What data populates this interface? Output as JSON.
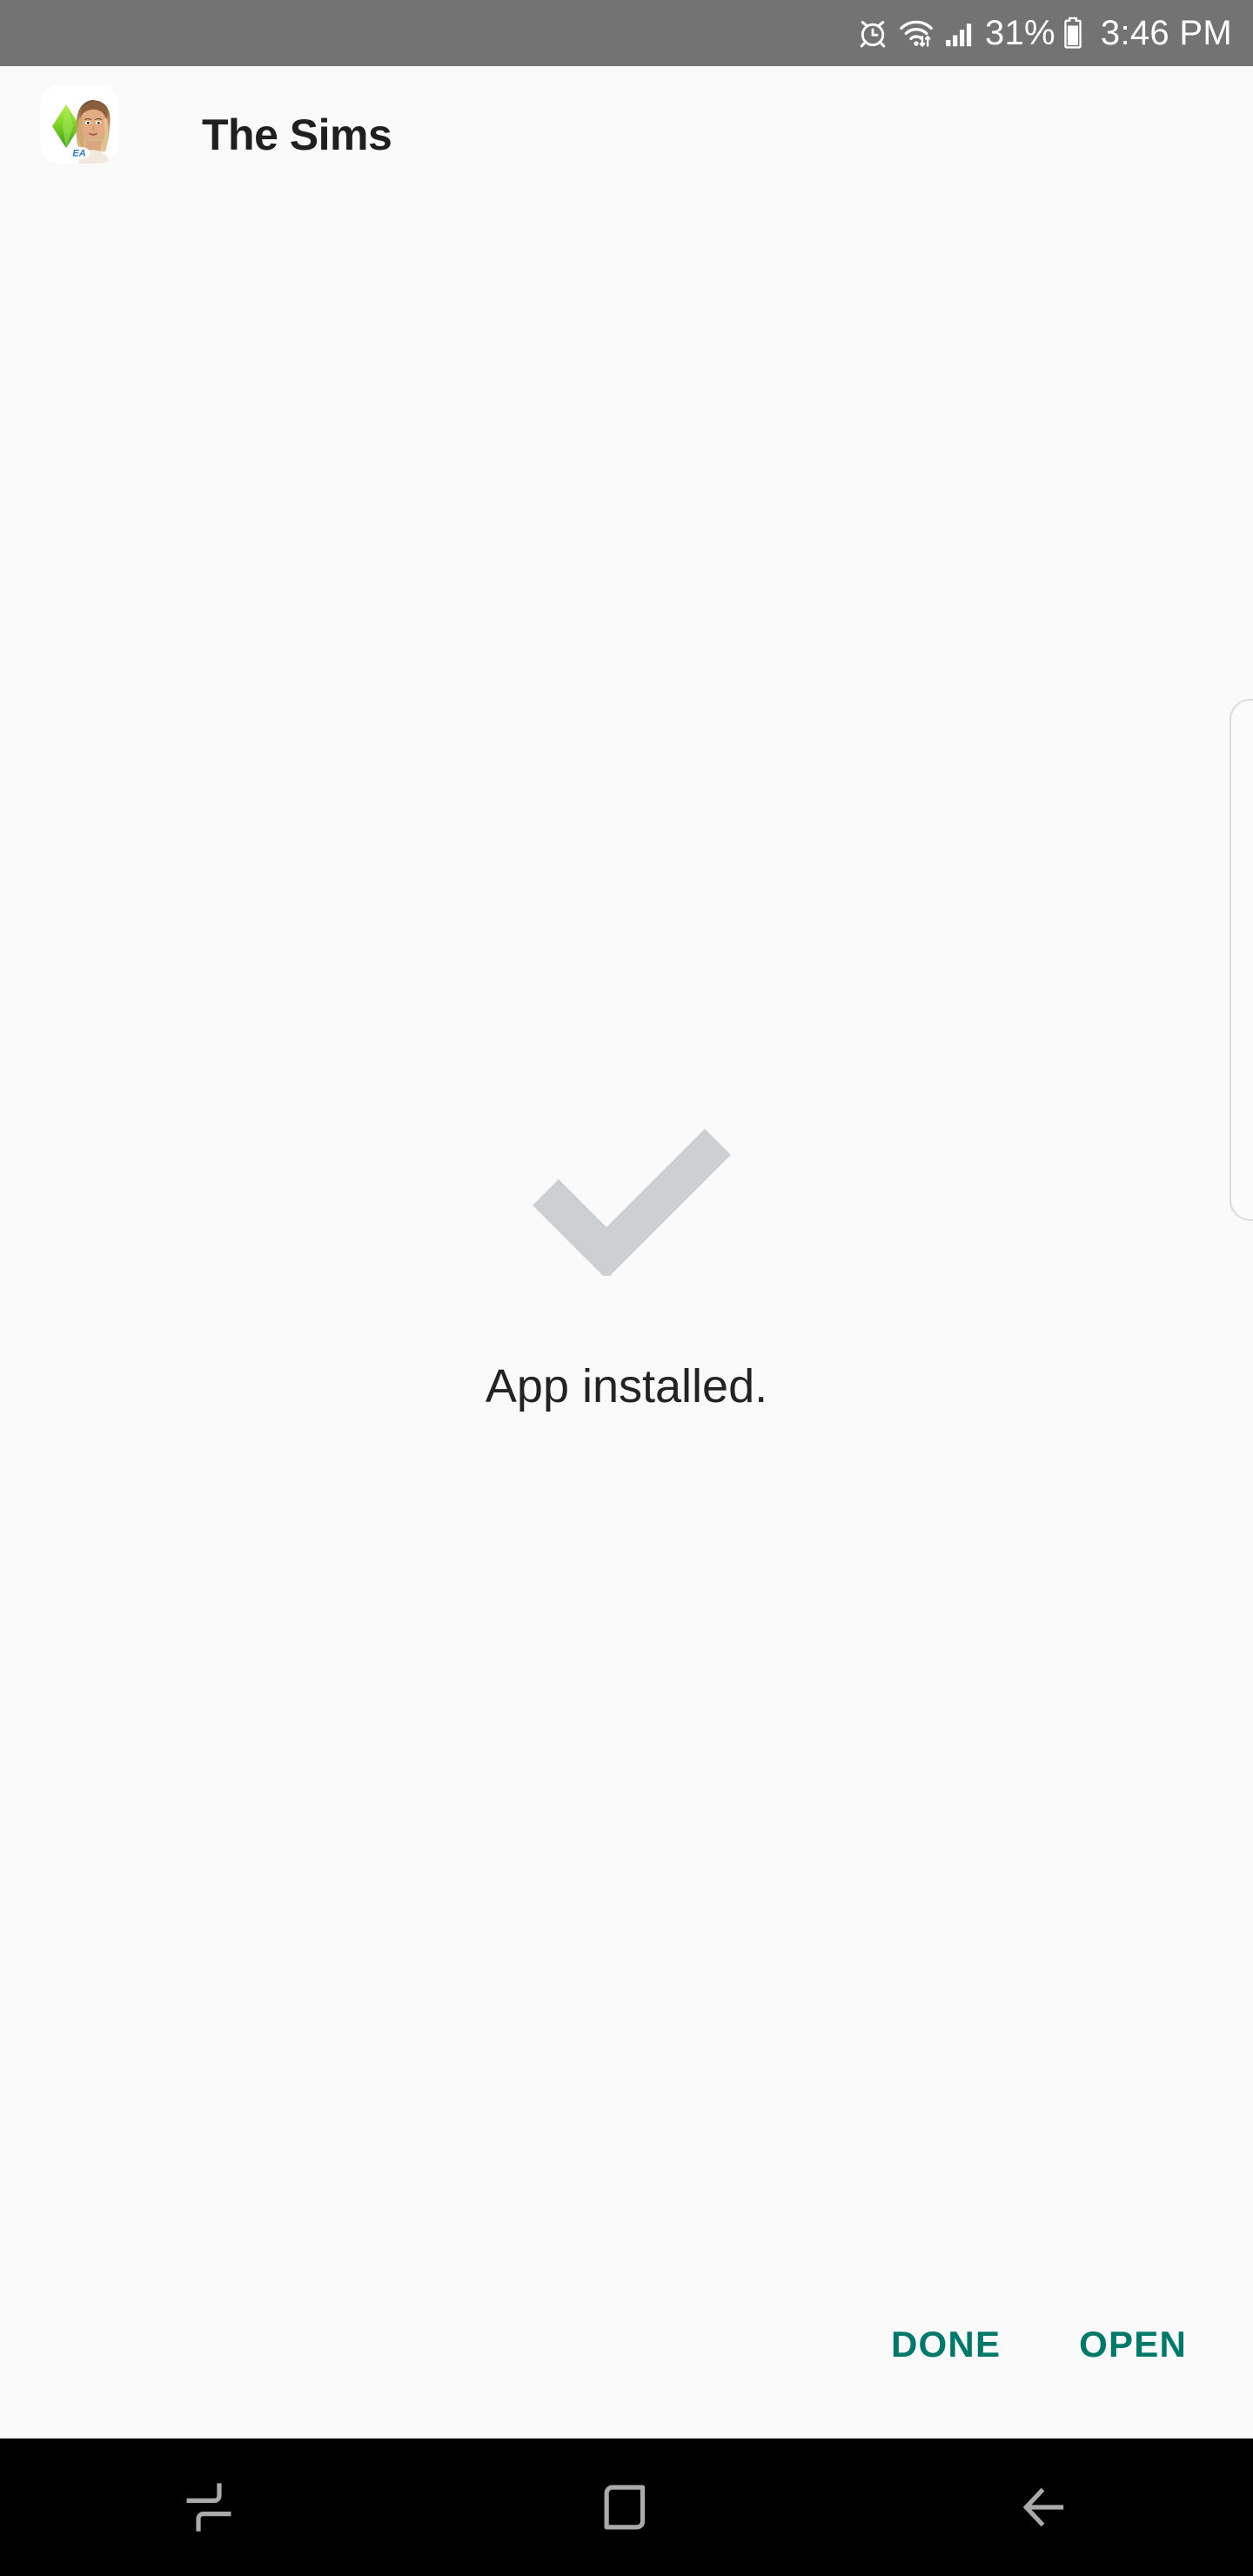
{
  "status_bar": {
    "background": "#737373",
    "icons": [
      {
        "name": "alarm-icon",
        "label": "alarm"
      },
      {
        "name": "wifi-transfer-icon",
        "label": "wifi with data transfer"
      },
      {
        "name": "signal-bars-icon",
        "label": "cellular signal"
      }
    ],
    "battery_percent": "31%",
    "battery_icon": "battery-icon",
    "clock": "3:46 PM",
    "text_color": "#ffffff"
  },
  "header": {
    "app_icon_name": "the-sims-app-icon",
    "app_icon_alt": "The Sims plumbob with sim character and EA logo",
    "title": "The Sims",
    "title_color": "#1f1f1f"
  },
  "main": {
    "check_icon_name": "installed-check-icon",
    "check_icon_color": "#cdd0d3",
    "status_text": "App installed.",
    "status_text_color": "#232323",
    "background": "#fafafa"
  },
  "actions": {
    "accent_color": "#00796b",
    "done_label": "DONE",
    "open_label": "OPEN"
  },
  "edge_panel": {
    "name": "edge-panel-handle",
    "border_color": "#dcdcdc"
  },
  "nav_bar": {
    "background": "#000000",
    "icon_color": "#aaaaaa",
    "buttons": [
      {
        "name": "recents-button",
        "icon": "recents-icon",
        "label": "Recents"
      },
      {
        "name": "home-button",
        "icon": "home-icon",
        "label": "Home"
      },
      {
        "name": "back-button",
        "icon": "back-arrow-icon",
        "label": "Back"
      }
    ]
  }
}
